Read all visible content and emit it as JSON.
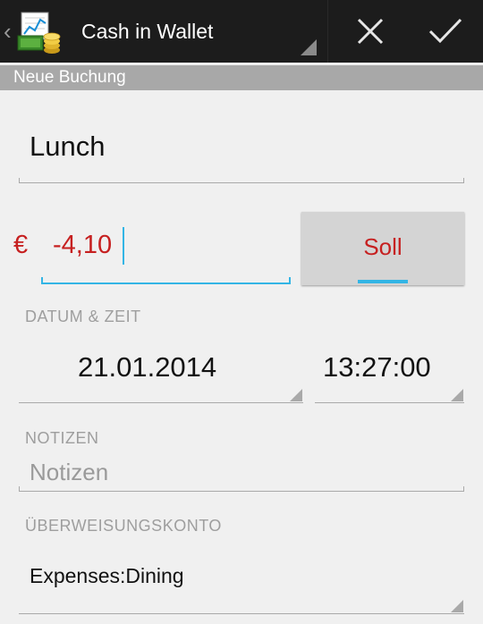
{
  "actionbar": {
    "title": "Cash in Wallet",
    "back_icon": "chevron-left-icon",
    "app_icon": "wallet-chart-coins-icon",
    "cancel_icon": "close-icon",
    "confirm_icon": "check-icon"
  },
  "subheader": {
    "title": "Neue Buchung"
  },
  "form": {
    "description": {
      "value": "Lunch"
    },
    "currency_symbol": "€",
    "amount": {
      "value": "-4,10"
    },
    "type_toggle": {
      "label": "Soll"
    },
    "datetime_section": {
      "label": "DATUM & ZEIT",
      "date": "21.01.2014",
      "time": "13:27:00"
    },
    "notes_section": {
      "label": "NOTIZEN",
      "placeholder": "Notizen"
    },
    "account_section": {
      "label": "ÜBERWEISUNGSKONTO",
      "value": "Expenses:Dining"
    }
  },
  "colors": {
    "actionbar_bg": "#1c1c1c",
    "subheader_bg": "#a8a8a8",
    "negative_amount": "#c62020",
    "accent": "#33b5e5",
    "background": "#f0f0f0"
  }
}
